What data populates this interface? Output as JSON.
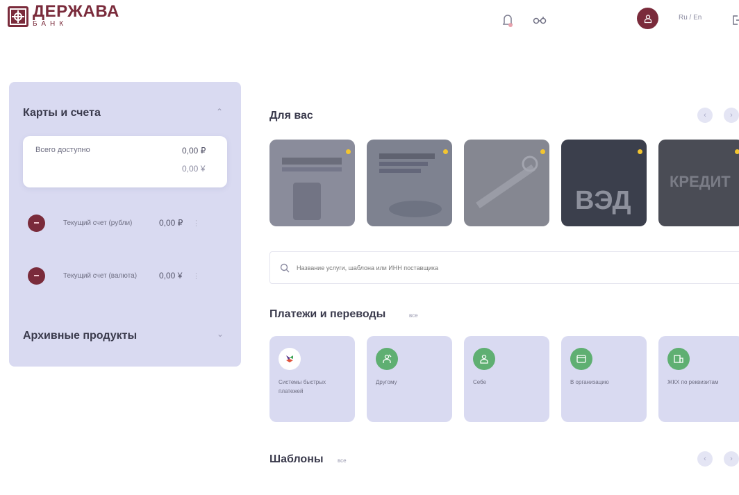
{
  "header": {
    "logo_title": "ДЕРЖАВА",
    "logo_subtitle": "БАНК",
    "lang": "Ru / En"
  },
  "accounts_panel": {
    "title": "Карты и счета",
    "available_label": "Всего доступно",
    "available_rub": "0,00 ₽",
    "available_usd": "0,00 ¥",
    "items": [
      {
        "name": "Текущий счет (рубли)",
        "value": "0,00 ₽"
      },
      {
        "name": "Текущий счет (валюта)",
        "value": "0,00 ¥"
      }
    ],
    "archive_title": "Архивные продукты"
  },
  "for_you": {
    "title": "Для вас",
    "promos": [
      {
        "caption": "",
        "colors": [
          "#8a8c9b",
          "#767886"
        ]
      },
      {
        "caption": "",
        "colors": [
          "#7e8290",
          "#6c6f7d"
        ]
      },
      {
        "caption": "",
        "colors": [
          "#858791",
          "#6f717c"
        ]
      },
      {
        "caption": "ВЭД",
        "colors": [
          "#3b3f4c",
          "#2e3140"
        ]
      },
      {
        "caption": "КРЕДИТ",
        "colors": [
          "#4a4c55",
          "#3a3c44"
        ]
      }
    ]
  },
  "search": {
    "placeholder": "Название услуги, шаблона или ИНН поставщика"
  },
  "payments": {
    "title": "Платежи и переводы",
    "all_link": "все",
    "tiles": [
      {
        "label": "Системы быстрых платежей"
      },
      {
        "label": "Другому"
      },
      {
        "label": "Себе"
      },
      {
        "label": "В организацию"
      },
      {
        "label": "ЖКХ по реквизитам"
      }
    ]
  },
  "templates": {
    "title": "Шаблоны",
    "all_link": "все"
  },
  "colors": {
    "brand": "#7a2b3b",
    "panel": "#d9daf1",
    "accent_green": "#5faf72"
  }
}
